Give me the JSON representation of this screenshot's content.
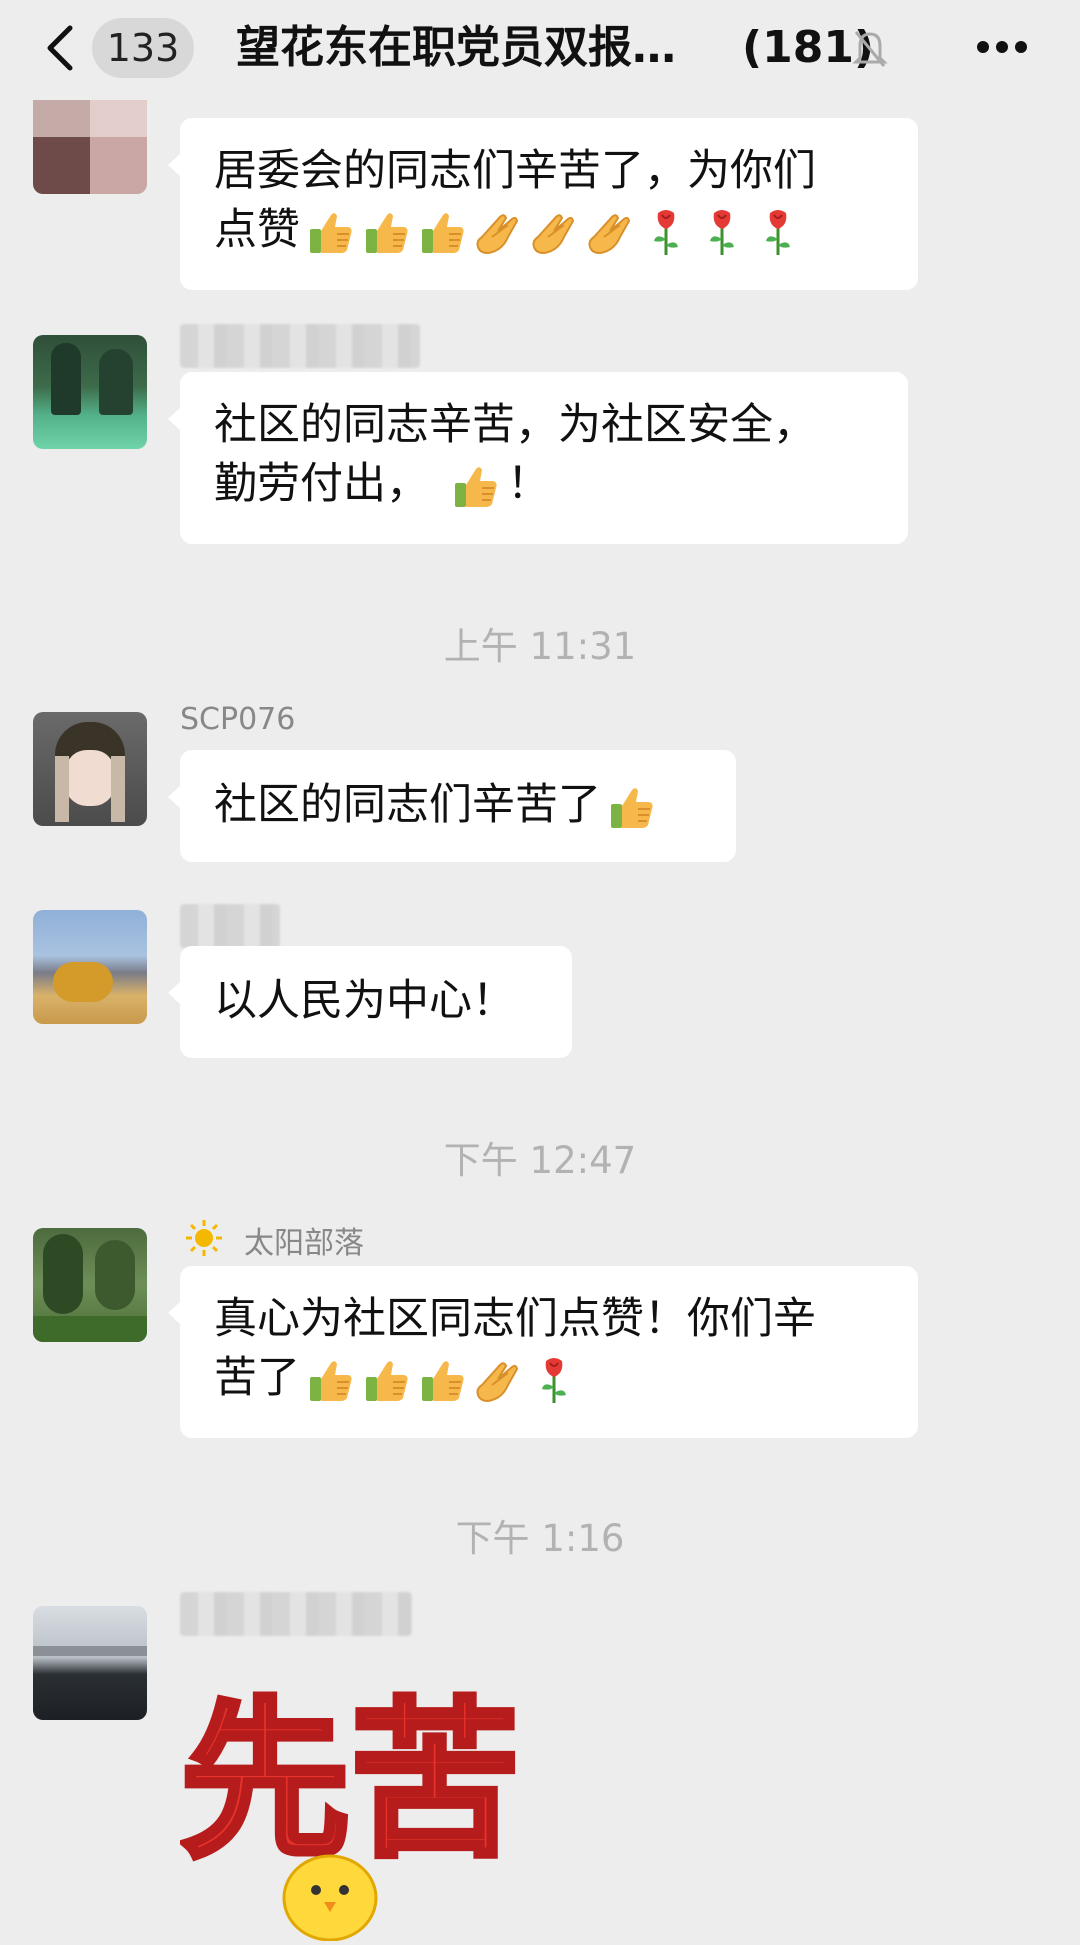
{
  "header": {
    "back_icon": "chevron-left-icon",
    "unread_count": "133",
    "title": "望花东在职党员双报…",
    "member_count": "(181)",
    "mute_icon": "bell-off-icon",
    "more_icon": "more-icon"
  },
  "messages": [
    {
      "name": "",
      "lines": [
        "居委会的同志们辛苦了，为你们",
        "点赞"
      ],
      "emoji": [
        "thumbs-up",
        "thumbs-up",
        "thumbs-up",
        "clap",
        "clap",
        "clap",
        "rose",
        "rose",
        "rose"
      ]
    },
    {
      "name": "",
      "lines": [
        "社区的同志辛苦，为社区安全，",
        "勤劳付出，",
        "！"
      ],
      "emoji": [
        "thumbs-up"
      ]
    },
    {
      "name": "SCP076",
      "lines": [
        "社区的同志们辛苦了"
      ],
      "emoji": [
        "thumbs-up"
      ]
    },
    {
      "name": "",
      "lines": [
        "以人民为中心！"
      ],
      "emoji": []
    },
    {
      "name_icon": "sun-icon",
      "name": "太阳部落",
      "lines": [
        "真心为社区同志们点赞！你们辛",
        "苦了"
      ],
      "emoji": [
        "thumbs-up",
        "thumbs-up",
        "thumbs-up",
        "clap",
        "rose"
      ]
    },
    {
      "name": "",
      "sticker_text": "先苦",
      "sticker": "chick-sticker"
    }
  ],
  "timestamps": [
    "上午 11:31",
    "下午 12:47",
    "下午 1:16"
  ],
  "colors": {
    "background": "#ededed",
    "bubble": "#ffffff",
    "timestamp": "#b2b2b2",
    "sticker_red": "#e8332b"
  }
}
